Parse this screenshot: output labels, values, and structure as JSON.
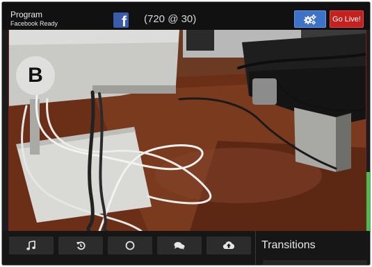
{
  "header": {
    "title": "Program",
    "status": "Facebook Ready",
    "resolution": "(720 @ 30)",
    "destination_icon": "facebook-icon",
    "settings_icon": "gears-icon",
    "go_live_label": "Go Live!"
  },
  "preview": {
    "source_label": "B",
    "scene": "live camera feed of a desk with a computer stand, cables and a monitor stand"
  },
  "toolbar": {
    "buttons": [
      {
        "name": "music-button",
        "icon": "music-note-icon"
      },
      {
        "name": "replay-button",
        "icon": "replay-icon"
      },
      {
        "name": "record-button",
        "icon": "circle-icon"
      },
      {
        "name": "comments-button",
        "icon": "chat-bubbles-icon"
      },
      {
        "name": "upload-button",
        "icon": "cloud-upload-icon"
      }
    ],
    "transitions_label": "Transitions"
  },
  "colors": {
    "settings": "#3d72c9",
    "go_live": "#c3201e",
    "audio_meter": "#45c04a",
    "facebook": "#3b5bab"
  }
}
